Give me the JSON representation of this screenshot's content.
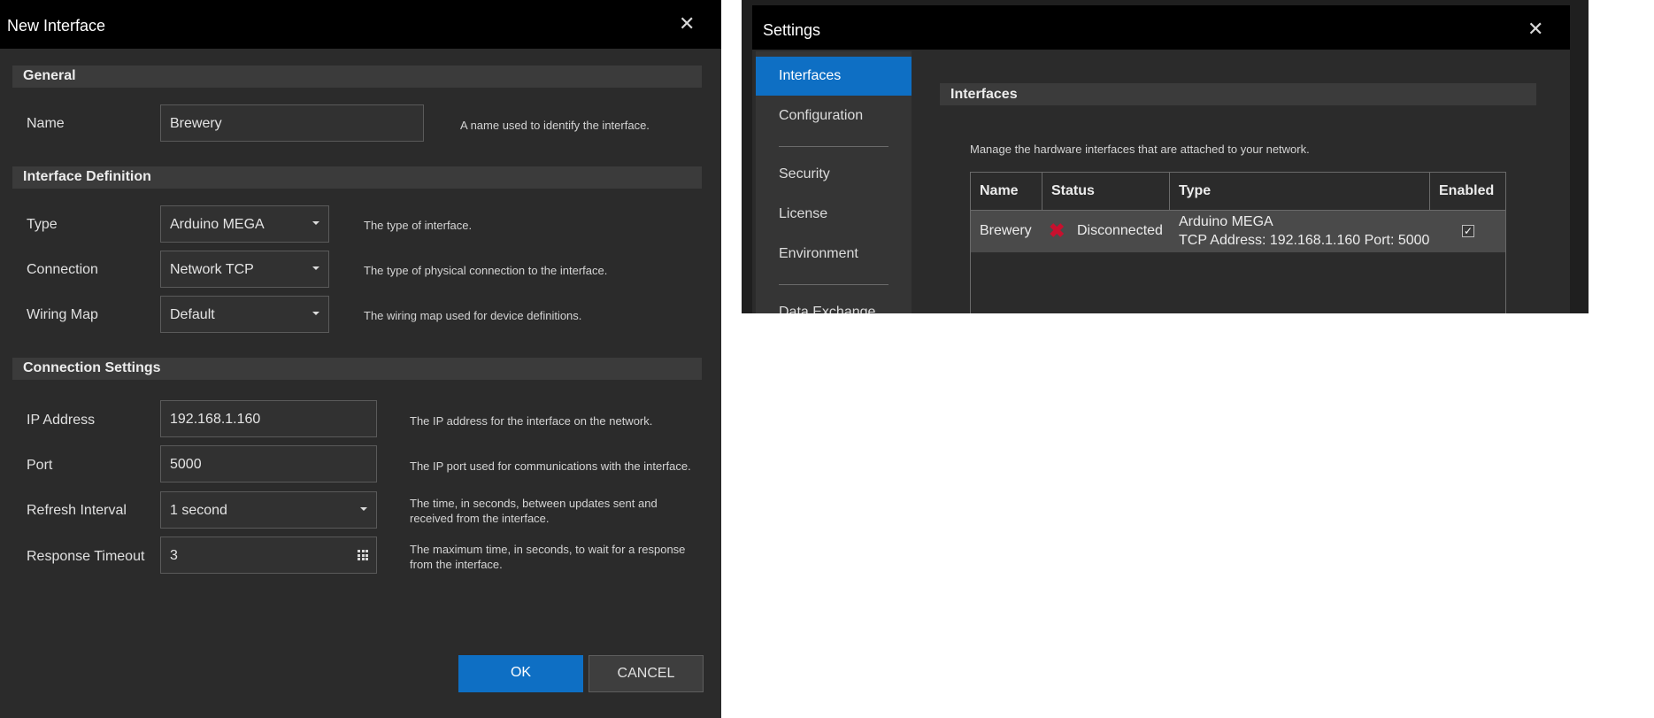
{
  "dialog": {
    "title": "New Interface",
    "close_glyph": "✕",
    "sections": {
      "general": "General",
      "definition": "Interface Definition",
      "connection": "Connection Settings"
    },
    "fields": {
      "name": {
        "label": "Name",
        "value": "Brewery",
        "help": "A name used to identify the interface."
      },
      "type": {
        "label": "Type",
        "value": "Arduino MEGA",
        "help": "The type of interface."
      },
      "connection": {
        "label": "Connection",
        "value": "Network TCP",
        "help": "The type of physical connection to the interface."
      },
      "wiring_map": {
        "label": "Wiring Map",
        "value": "Default",
        "help": "The wiring map used for device definitions."
      },
      "ip_address": {
        "label": "IP Address",
        "value": "192.168.1.160",
        "help": "The IP address for the interface on the network."
      },
      "port": {
        "label": "Port",
        "value": "5000",
        "help": "The IP port used for communications with the interface."
      },
      "refresh_interval": {
        "label": "Refresh Interval",
        "value": "1 second",
        "help_line1": "The time, in seconds, between updates sent and",
        "help_line2": "received from the interface."
      },
      "response_timeout": {
        "label": "Response Timeout",
        "value": "3",
        "help_line1": "The maximum time, in seconds, to wait for a response",
        "help_line2": "from the interface."
      }
    },
    "buttons": {
      "ok": "OK",
      "cancel": "CANCEL"
    },
    "icons": {
      "dropdown": "caret-down-icon",
      "stepper": "keypad-icon",
      "close": "close-icon"
    },
    "colors": {
      "accent": "#0e6fc4",
      "background": "#2b2b2b",
      "titlebar": "#000000"
    }
  },
  "settings": {
    "title": "Settings",
    "close_glyph": "✕",
    "nav": [
      {
        "label": "Interfaces",
        "active": true
      },
      {
        "label": "Configuration",
        "active": false
      },
      {
        "label": "Security",
        "active": false
      },
      {
        "label": "License",
        "active": false
      },
      {
        "label": "Environment",
        "active": false
      },
      {
        "label": "Data Exchange",
        "active": false
      }
    ],
    "section": "Interfaces",
    "description": "Manage the hardware interfaces that are attached to your network.",
    "table": {
      "headers": [
        "Name",
        "Status",
        "Type",
        "Enabled"
      ],
      "rows": [
        {
          "name": "Brewery",
          "status_icon": "x-mark-icon",
          "status": "Disconnected",
          "type_line1": "Arduino MEGA",
          "type_line2": "TCP Address: 192.168.1.160 Port: 5000",
          "enabled": true,
          "enabled_glyph": "✓"
        }
      ]
    },
    "colors": {
      "status_error": "#c8102e",
      "selected_row": "#4a4a4a"
    }
  }
}
